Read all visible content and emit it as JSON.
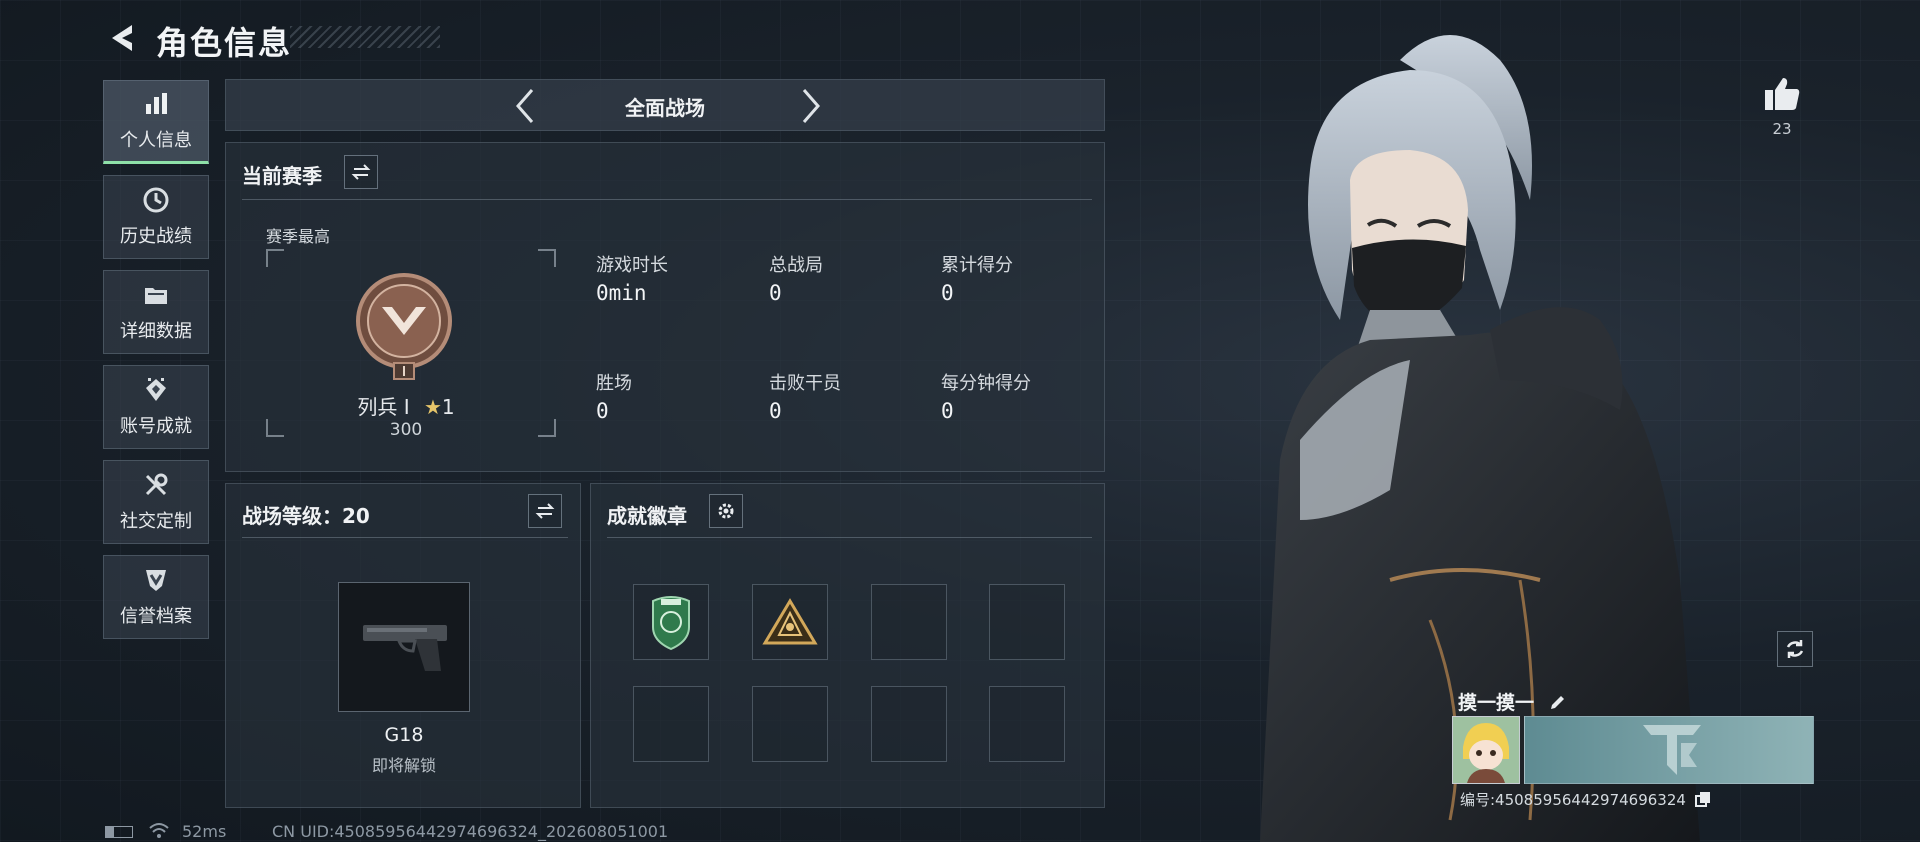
{
  "header": {
    "title": "角色信息"
  },
  "sidebar": {
    "items": [
      {
        "label": "个人信息",
        "icon": "bar-chart-icon",
        "active": true
      },
      {
        "label": "历史战绩",
        "icon": "clock-history-icon"
      },
      {
        "label": "详细数据",
        "icon": "folder-icon"
      },
      {
        "label": "账号成就",
        "icon": "achievement-icon"
      },
      {
        "label": "社交定制",
        "icon": "wrench-tools-icon"
      },
      {
        "label": "信誉档案",
        "icon": "shield-check-icon"
      }
    ]
  },
  "mode_selector": {
    "current": "全面战场"
  },
  "season": {
    "title": "当前赛季",
    "best_label": "赛季最高",
    "rank_name": "列兵 I",
    "rank_stars": "1",
    "rank_points": "300",
    "stats": [
      {
        "label": "游戏时长",
        "value": "0min"
      },
      {
        "label": "总战局",
        "value": "0"
      },
      {
        "label": "累计得分",
        "value": "0"
      },
      {
        "label": "胜场",
        "value": "0"
      },
      {
        "label": "击败干员",
        "value": "0"
      },
      {
        "label": "每分钟得分",
        "value": "0"
      }
    ]
  },
  "battlefield_level": {
    "title": "战场等级：20",
    "weapon_name": "G18",
    "weapon_status": "即将解锁"
  },
  "achievements": {
    "title": "成就徽章"
  },
  "profile": {
    "likes": "23",
    "nickname": "摸一摸一",
    "player_id": "编号:4508595644297469632​4"
  },
  "status_bar": {
    "ping": "52ms",
    "uid": "CN UID:450859564429746963​24_202608051001"
  },
  "colors": {
    "accent_green": "#8ee0a8",
    "panel_bg": "#28323c"
  }
}
